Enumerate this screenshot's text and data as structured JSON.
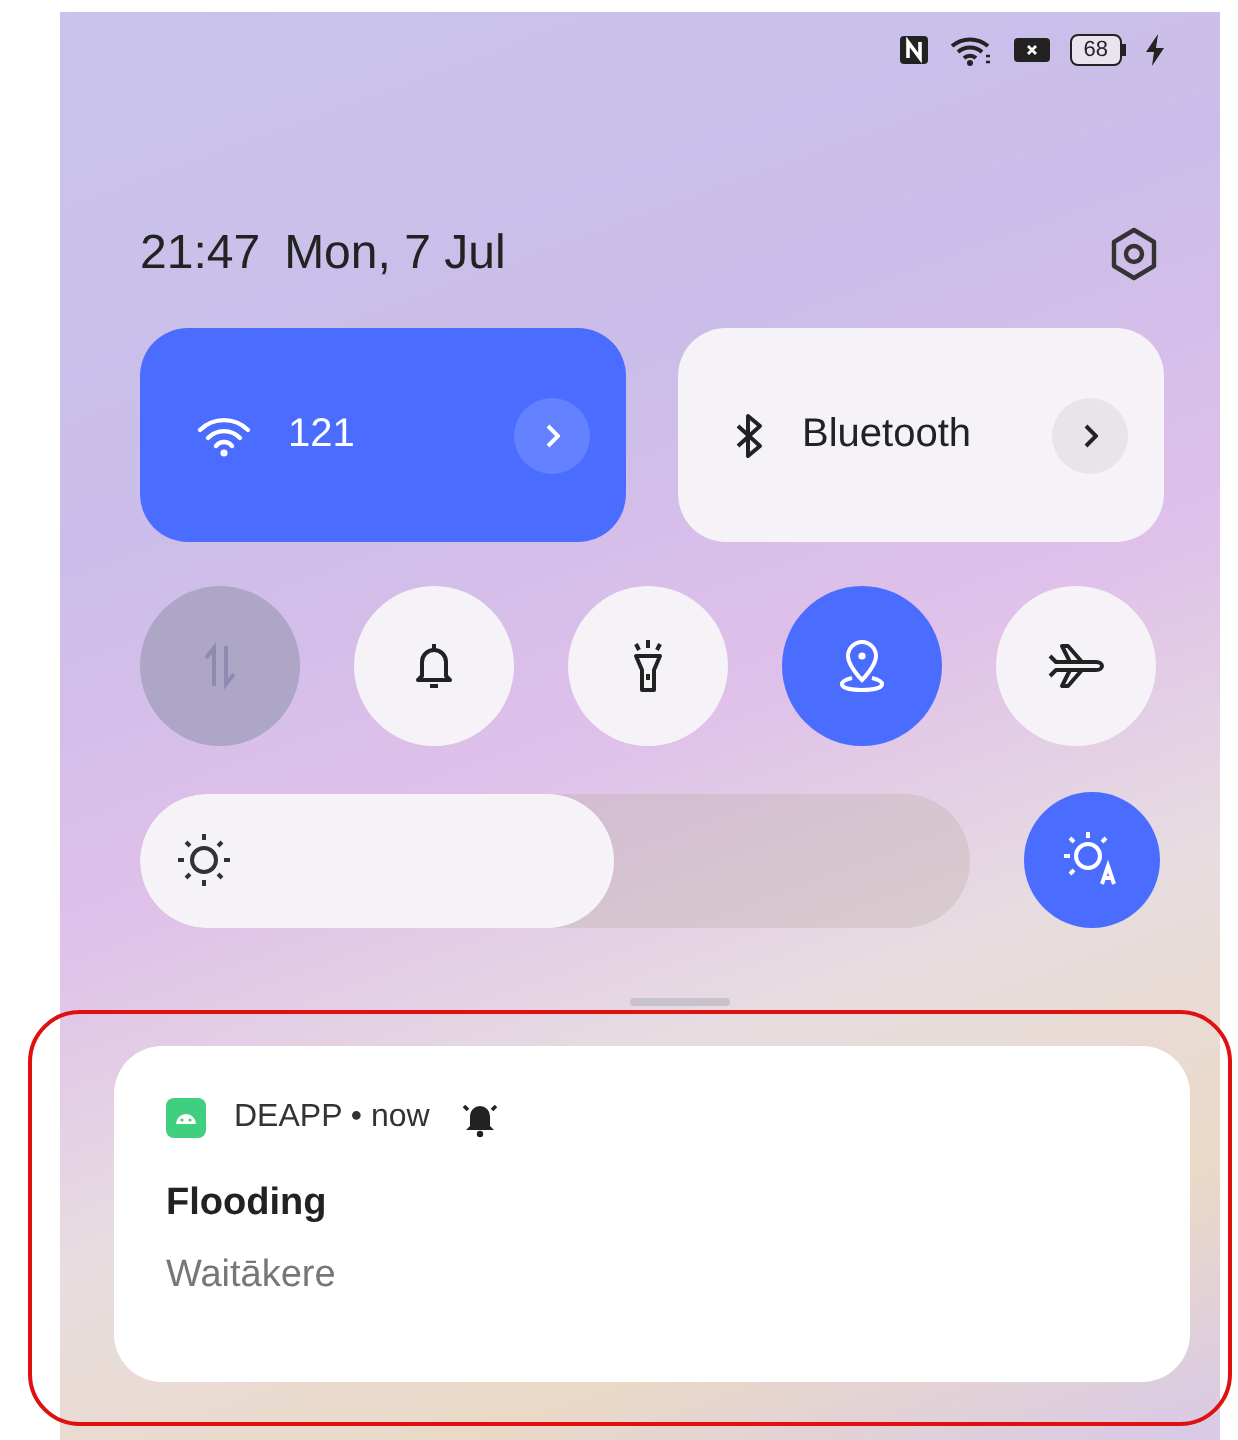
{
  "status_bar": {
    "battery": "68",
    "charging": true
  },
  "header": {
    "time": "21:47",
    "date": "Mon, 7 Jul"
  },
  "tiles": [
    {
      "kind": "wifi",
      "label": "121",
      "on": true
    },
    {
      "kind": "bluetooth",
      "label": "Bluetooth",
      "on": false
    }
  ],
  "toggles": [
    {
      "kind": "data",
      "on": false,
      "disabled": true
    },
    {
      "kind": "sound",
      "on": false,
      "disabled": false
    },
    {
      "kind": "torch",
      "on": false,
      "disabled": false
    },
    {
      "kind": "location",
      "on": true,
      "disabled": false
    },
    {
      "kind": "airplane",
      "on": false,
      "disabled": false
    }
  ],
  "brightness": {
    "level": 0.57,
    "auto": true
  },
  "notification": {
    "app": "DEAPP • now",
    "title": "Flooding",
    "body": "Waitākere",
    "highlighted": true
  }
}
